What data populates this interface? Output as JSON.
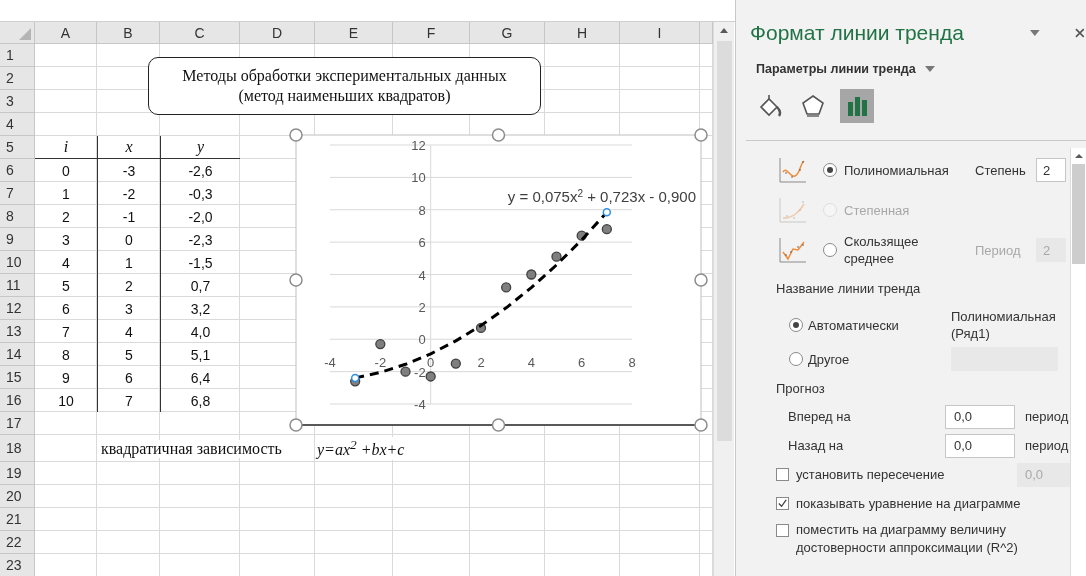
{
  "sheet": {
    "columns": [
      "A",
      "B",
      "C",
      "D",
      "E",
      "F",
      "G",
      "H",
      "I"
    ],
    "rows": [
      {
        "number": "1"
      },
      {
        "number": "2"
      },
      {
        "number": "3"
      },
      {
        "number": "4"
      },
      {
        "number": "5",
        "kind": "header",
        "cells": [
          "i",
          "x",
          "y"
        ]
      },
      {
        "number": "6",
        "cells": [
          "0",
          "-3",
          "-2,6"
        ]
      },
      {
        "number": "7",
        "cells": [
          "1",
          "-2",
          "-0,3"
        ]
      },
      {
        "number": "8",
        "cells": [
          "2",
          "-1",
          "-2,0"
        ]
      },
      {
        "number": "9",
        "cells": [
          "3",
          "0",
          "-2,3"
        ]
      },
      {
        "number": "10",
        "cells": [
          "4",
          "1",
          "-1,5"
        ]
      },
      {
        "number": "11",
        "cells": [
          "5",
          "2",
          "0,7"
        ]
      },
      {
        "number": "12",
        "cells": [
          "6",
          "3",
          "3,2"
        ]
      },
      {
        "number": "13",
        "cells": [
          "7",
          "4",
          "4,0"
        ]
      },
      {
        "number": "14",
        "cells": [
          "8",
          "5",
          "5,1"
        ]
      },
      {
        "number": "15",
        "cells": [
          "9",
          "6",
          "6,4"
        ]
      },
      {
        "number": "16",
        "cells": [
          "10",
          "7",
          "6,8"
        ]
      },
      {
        "number": "17"
      },
      {
        "number": "18",
        "note": {
          "text": "квадратичная зависимость",
          "formula": "y=ax$^{2}$ +bx+c"
        }
      },
      {
        "number": "19"
      },
      {
        "number": "20"
      },
      {
        "number": "21"
      },
      {
        "number": "22"
      },
      {
        "number": "23"
      }
    ],
    "text_box": {
      "lines": [
        "Методы обработки экспериментальных данных",
        "(метод наименьших квадратов)"
      ]
    },
    "chart": {
      "chart_data": {
        "type": "scatter",
        "x": [
          -3,
          -2,
          -1,
          0,
          1,
          2,
          3,
          4,
          5,
          6,
          7
        ],
        "series": [
          {
            "color": "#7f7f7f",
            "values": [
              -2.6,
              -0.3,
              -2.0,
              -2.3,
              -1.5,
              0.7,
              3.2,
              4.0,
              5.1,
              6.4,
              6.8
            ]
          },
          {
            "type": "line",
            "line_style": "dashed",
            "color": "#000000",
            "values": [
              -2.39,
              -2.05,
              -1.55,
              -0.9,
              -0.1,
              0.85,
              1.94,
              3.19,
              4.59,
              6.14,
              7.84
            ]
          }
        ],
        "grid": true,
        "xlim": [
          -4,
          8
        ],
        "ylim": [
          -4,
          12
        ],
        "xticks": [
          -4,
          -2,
          0,
          2,
          4,
          6,
          8
        ],
        "yticks": [
          -4,
          -2,
          0,
          2,
          4,
          6,
          8,
          10,
          12
        ],
        "annotations": [
          {
            "text": "y = 0,075x$^{2}$ + 0,723x - 0,900"
          }
        ]
      }
    }
  },
  "panel": {
    "title": "Формат линии тренда",
    "section": "Параметры линии тренда",
    "tabs": [
      {
        "selected": false
      },
      {
        "selected": false
      },
      {
        "selected": true
      }
    ],
    "trend_types": [
      {
        "kind": "polynomial",
        "label": "Полиномиальная",
        "selected": true,
        "disabled": false,
        "param": {
          "label": "Степень",
          "value": "2",
          "disabled": false
        }
      },
      {
        "kind": "power",
        "label": "Степенная",
        "selected": false,
        "disabled": true
      },
      {
        "kind": "moving_average",
        "label": "Скользящее среднее",
        "selected": false,
        "disabled": false,
        "param": {
          "label": "Период",
          "value": "2",
          "disabled": true
        }
      }
    ],
    "name_section": {
      "label": "Название линии тренда",
      "options": [
        {
          "label": "Автоматически",
          "selected": true,
          "value": "Полиномиальная (Ряд1)"
        },
        {
          "label": "Другое",
          "selected": false,
          "field": {
            "disabled": true
          }
        }
      ]
    },
    "forecast": {
      "label": "Прогноз",
      "rows": [
        {
          "label": "Вперед на",
          "value": "0,0",
          "unit": "период"
        },
        {
          "label": "Назад на",
          "value": "0,0",
          "unit": "период"
        }
      ]
    },
    "checks": [
      {
        "label": "установить пересечение",
        "checked": false,
        "field": {
          "value": "0,0",
          "disabled": true
        }
      },
      {
        "label": "показывать уравнение на диаграмме",
        "checked": true
      },
      {
        "label": "поместить на диаграмму величину достоверности аппроксимации (R^2)",
        "checked": false
      }
    ]
  }
}
